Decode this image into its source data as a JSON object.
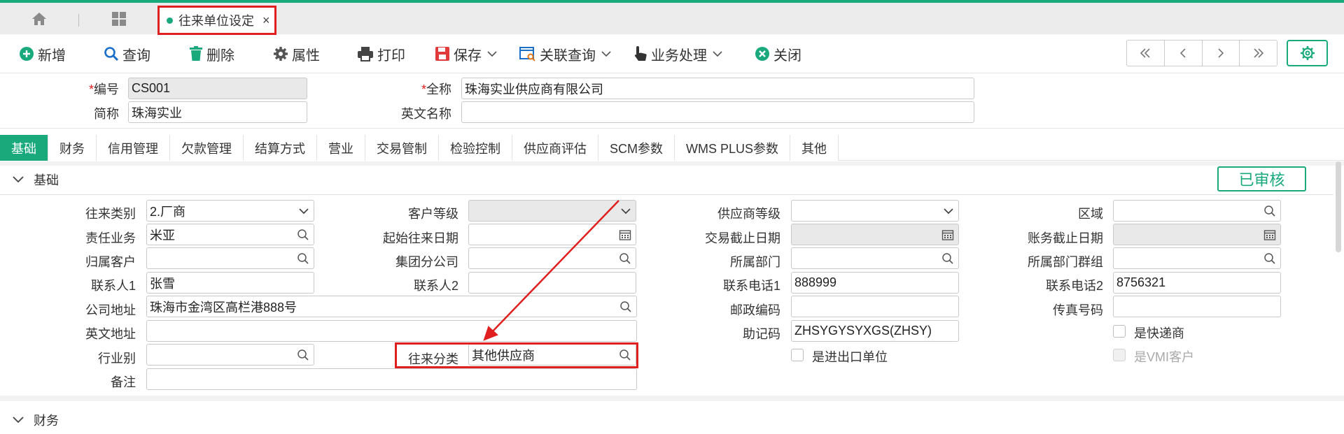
{
  "tabbar": {
    "home_icon": "home-icon",
    "apps_icon": "grid-icon",
    "active_tab": {
      "label": "往来单位设定",
      "close": "×"
    }
  },
  "toolbar": {
    "add": "新增",
    "query": "查询",
    "delete": "删除",
    "properties": "属性",
    "print": "打印",
    "save": "保存",
    "related_query": "关联查询",
    "business": "业务处理",
    "close": "关闭"
  },
  "header": {
    "code_label": "编号",
    "code_value": "CS001",
    "fullname_label": "全称",
    "fullname_value": "珠海实业供应商有限公司",
    "shortname_label": "简称",
    "shortname_value": "珠海实业",
    "english_name_label": "英文名称",
    "english_name_value": "",
    "required_mark": "*"
  },
  "tabs": [
    "基础",
    "财务",
    "信用管理",
    "欠款管理",
    "结算方式",
    "营业",
    "交易管制",
    "检验控制",
    "供应商评估",
    "SCM参数",
    "WMS PLUS参数",
    "其他"
  ],
  "section_basic": {
    "title": "基础",
    "status": "已审核",
    "fields": {
      "partner_type_label": "往来类别",
      "partner_type_value": "2.厂商",
      "responsible_label": "责任业务",
      "responsible_value": "米亚",
      "owner_customer_label": "归属客户",
      "owner_customer_value": "",
      "contact1_label": "联系人1",
      "contact1_value": "张雪",
      "address_label": "公司地址",
      "address_value": "珠海市金湾区高栏港888号",
      "en_address_label": "英文地址",
      "en_address_value": "",
      "industry_label": "行业别",
      "industry_value": "",
      "remark_label": "备注",
      "remark_value": "",
      "customer_level_label": "客户等级",
      "customer_level_value": "",
      "start_date_label": "起始往来日期",
      "start_date_value": "",
      "group_company_label": "集团分公司",
      "group_company_value": "",
      "contact2_label": "联系人2",
      "contact2_value": "",
      "category_label": "往来分类",
      "category_value": "其他供应商",
      "supplier_level_label": "供应商等级",
      "supplier_level_value": "",
      "trade_end_label": "交易截止日期",
      "trade_end_value": "",
      "department_label": "所属部门",
      "department_value": "",
      "phone1_label": "联系电话1",
      "phone1_value": "888999",
      "postal_label": "邮政编码",
      "postal_value": "",
      "mnemonic_label": "助记码",
      "mnemonic_value": "ZHSYGYSYXGS(ZHSY)",
      "import_export_label": "是进出口单位",
      "region_label": "区域",
      "region_value": "",
      "account_end_label": "账务截止日期",
      "account_end_value": "",
      "dept_group_label": "所属部门群组",
      "dept_group_value": "",
      "phone2_label": "联系电话2",
      "phone2_value": "8756321",
      "fax_label": "传真号码",
      "fax_value": "",
      "courier_label": "是快递商",
      "vmi_label": "是VMI客户"
    }
  },
  "section_finance": {
    "title": "财务"
  },
  "colors": {
    "accent": "#1aa97b",
    "highlight": "#e02020"
  }
}
